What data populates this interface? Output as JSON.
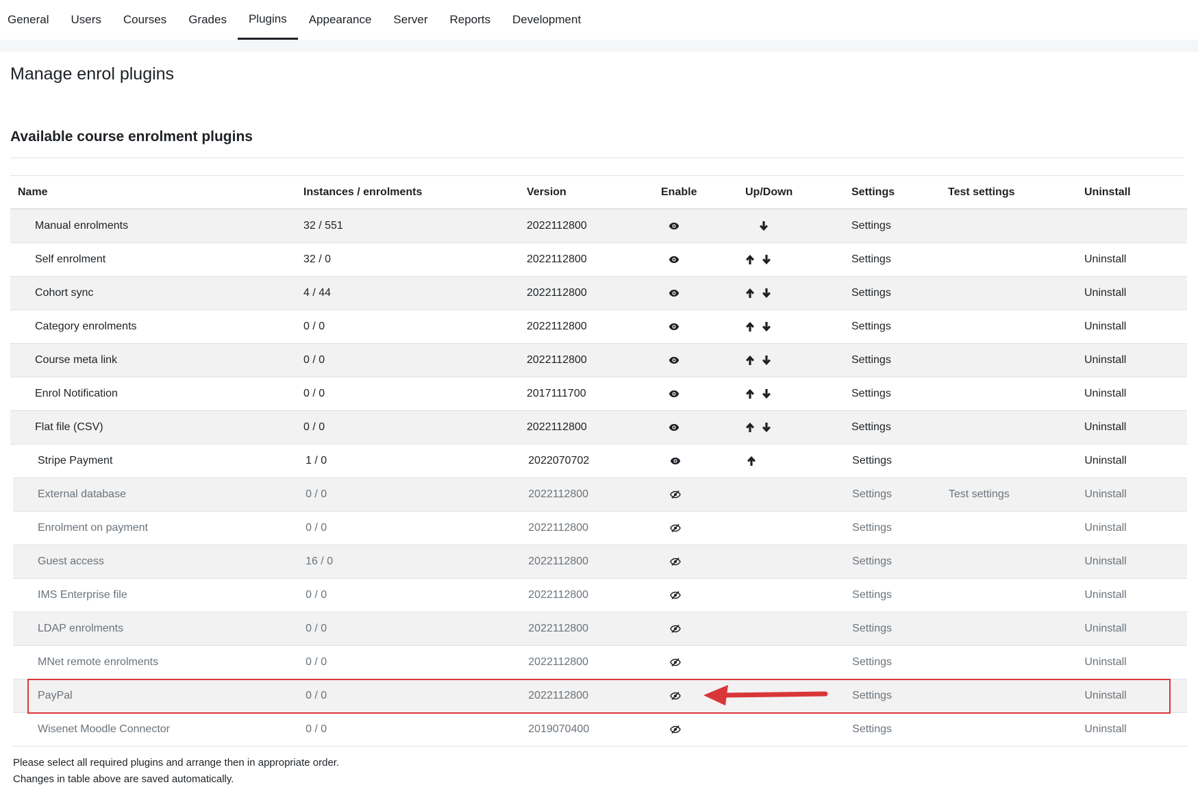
{
  "nav": {
    "tabs": [
      "General",
      "Users",
      "Courses",
      "Grades",
      "Plugins",
      "Appearance",
      "Server",
      "Reports",
      "Development"
    ],
    "active": "Plugins"
  },
  "page": {
    "title": "Manage enrol plugins",
    "section": "Available course enrolment plugins"
  },
  "table": {
    "headers": {
      "name": "Name",
      "instances": "Instances / enrolments",
      "version": "Version",
      "enable": "Enable",
      "updown": "Up/Down",
      "settings": "Settings",
      "test": "Test settings",
      "uninstall": "Uninstall"
    },
    "rows": [
      {
        "name": "Manual enrolments",
        "instances": "32 / 551",
        "version": "2022112800",
        "enabled": true,
        "up": false,
        "down": true,
        "settings": "Settings",
        "test": "",
        "uninstall": ""
      },
      {
        "name": "Self enrolment",
        "instances": "32 / 0",
        "version": "2022112800",
        "enabled": true,
        "up": true,
        "down": true,
        "settings": "Settings",
        "test": "",
        "uninstall": "Uninstall"
      },
      {
        "name": "Cohort sync",
        "instances": "4 / 44",
        "version": "2022112800",
        "enabled": true,
        "up": true,
        "down": true,
        "settings": "Settings",
        "test": "",
        "uninstall": "Uninstall"
      },
      {
        "name": "Category enrolments",
        "instances": "0 / 0",
        "version": "2022112800",
        "enabled": true,
        "up": true,
        "down": true,
        "settings": "Settings",
        "test": "",
        "uninstall": "Uninstall"
      },
      {
        "name": "Course meta link",
        "instances": "0 / 0",
        "version": "2022112800",
        "enabled": true,
        "up": true,
        "down": true,
        "settings": "Settings",
        "test": "",
        "uninstall": "Uninstall"
      },
      {
        "name": "Enrol Notification",
        "instances": "0 / 0",
        "version": "2017111700",
        "enabled": true,
        "up": true,
        "down": true,
        "settings": "Settings",
        "test": "",
        "uninstall": "Uninstall"
      },
      {
        "name": "Flat file (CSV)",
        "instances": "0 / 0",
        "version": "2022112800",
        "enabled": true,
        "up": true,
        "down": true,
        "settings": "Settings",
        "test": "",
        "uninstall": "Uninstall"
      },
      {
        "name": "Stripe Payment",
        "instances": "1 / 0",
        "version": "2022070702",
        "enabled": true,
        "up": true,
        "down": false,
        "settings": "Settings",
        "test": "",
        "uninstall": "Uninstall"
      },
      {
        "name": "External database",
        "instances": "0 / 0",
        "version": "2022112800",
        "enabled": false,
        "up": false,
        "down": false,
        "settings": "Settings",
        "test": "Test settings",
        "uninstall": "Uninstall"
      },
      {
        "name": "Enrolment on payment",
        "instances": "0 / 0",
        "version": "2022112800",
        "enabled": false,
        "up": false,
        "down": false,
        "settings": "Settings",
        "test": "",
        "uninstall": "Uninstall"
      },
      {
        "name": "Guest access",
        "instances": "16 / 0",
        "version": "2022112800",
        "enabled": false,
        "up": false,
        "down": false,
        "settings": "Settings",
        "test": "",
        "uninstall": "Uninstall"
      },
      {
        "name": "IMS Enterprise file",
        "instances": "0 / 0",
        "version": "2022112800",
        "enabled": false,
        "up": false,
        "down": false,
        "settings": "Settings",
        "test": "",
        "uninstall": "Uninstall"
      },
      {
        "name": "LDAP enrolments",
        "instances": "0 / 0",
        "version": "2022112800",
        "enabled": false,
        "up": false,
        "down": false,
        "settings": "Settings",
        "test": "",
        "uninstall": "Uninstall"
      },
      {
        "name": "MNet remote enrolments",
        "instances": "0 / 0",
        "version": "2022112800",
        "enabled": false,
        "up": false,
        "down": false,
        "settings": "Settings",
        "test": "",
        "uninstall": "Uninstall"
      },
      {
        "name": "PayPal",
        "instances": "0 / 0",
        "version": "2022112800",
        "enabled": false,
        "up": false,
        "down": false,
        "settings": "Settings",
        "test": "",
        "uninstall": "Uninstall"
      },
      {
        "name": "Wisenet Moodle Connector",
        "instances": "0 / 0",
        "version": "2019070400",
        "enabled": false,
        "up": false,
        "down": false,
        "settings": "Settings",
        "test": "",
        "uninstall": "Uninstall"
      }
    ]
  },
  "footer": {
    "line1": "Please select all required plugins and arrange then in appropriate order.",
    "line2": "Changes in table above are saved automatically."
  },
  "annotation": {
    "highlight": "PayPal",
    "color": "#d9363a"
  }
}
